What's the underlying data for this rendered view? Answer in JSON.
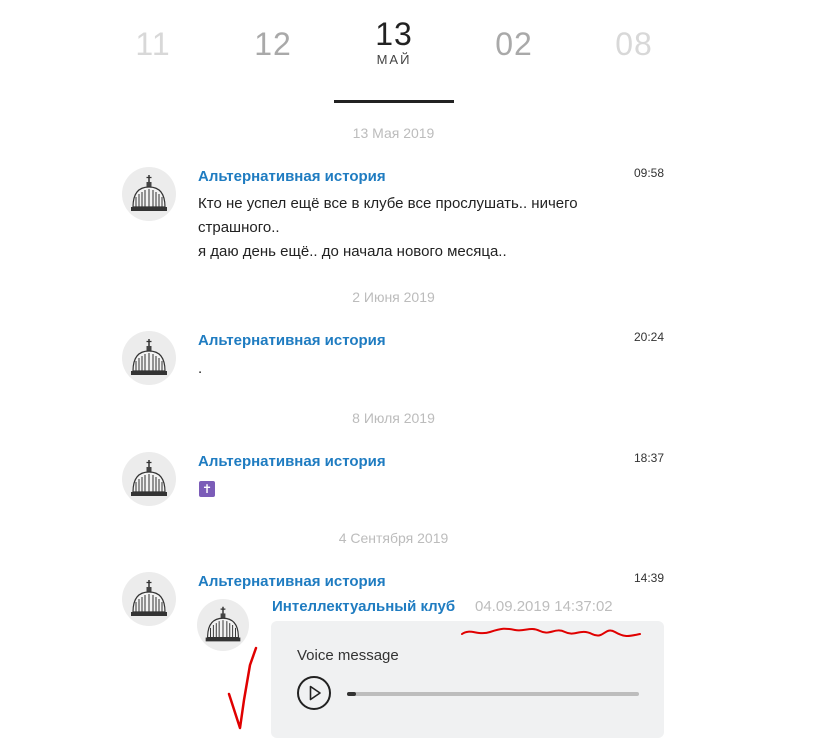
{
  "dates": [
    {
      "day": "11",
      "month": ""
    },
    {
      "day": "12",
      "month": ""
    },
    {
      "day": "13",
      "month": "МАЙ",
      "active": true
    },
    {
      "day": "02",
      "month": ""
    },
    {
      "day": "08",
      "month": ""
    }
  ],
  "day_separators": [
    "13 Мая 2019",
    "2 Июня 2019",
    "8 Июля 2019",
    "4 Сентября 2019"
  ],
  "messages": [
    {
      "author": "Альтернативная история",
      "time": "09:58",
      "lines": [
        "Кто не успел ещё все в клубе все прослушать.. ничего",
        "страшного..",
        "я даю день ещё.. до начала нового месяца.."
      ]
    },
    {
      "author": "Альтернативная история",
      "time": "20:24",
      "lines": [
        "."
      ]
    },
    {
      "author": "Альтернативная история",
      "time": "18:37",
      "emoji": "✝"
    },
    {
      "author": "Альтернативная история",
      "time": "14:39",
      "forwarded": {
        "author": "Интеллектуальный клуб",
        "date": "04.09.2019 14:37:02",
        "voice": {
          "label": "Voice message",
          "progress": 0.03
        }
      }
    }
  ],
  "colors": {
    "link": "#1f7cc1",
    "annotation": "#e00000"
  }
}
